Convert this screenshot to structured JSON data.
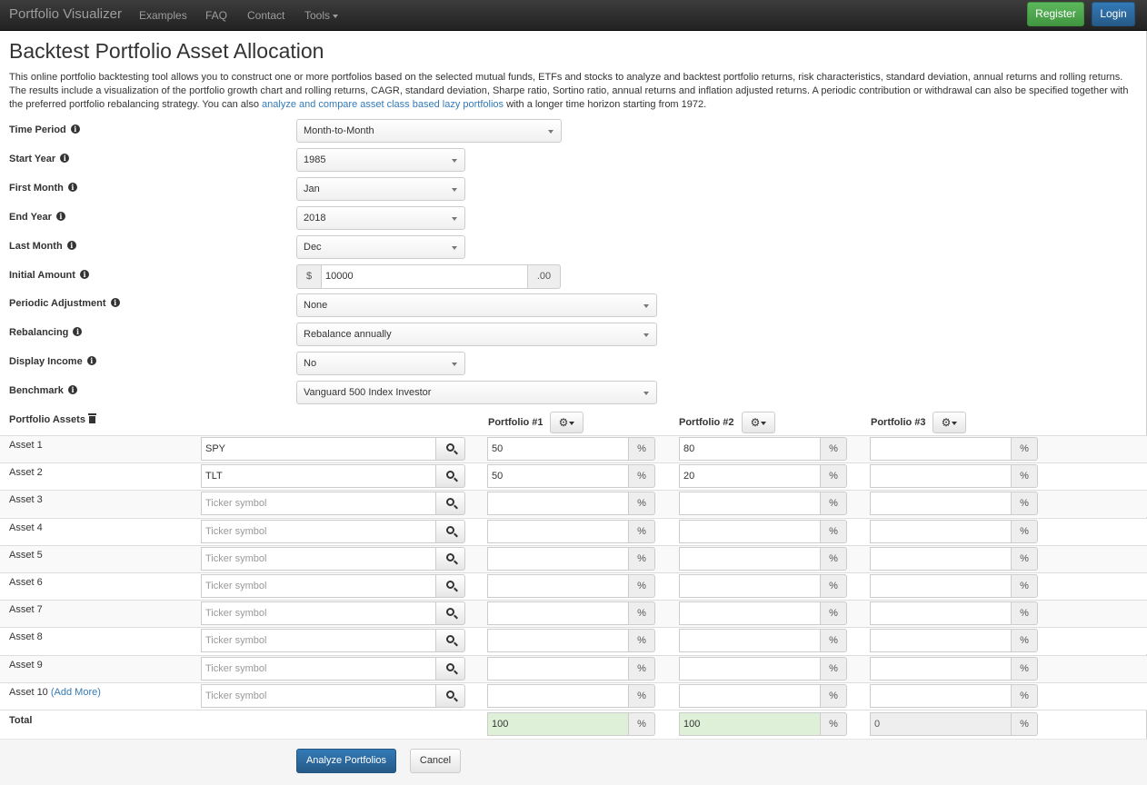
{
  "navbar": {
    "brand": "Portfolio Visualizer",
    "links": [
      "Examples",
      "FAQ",
      "Contact",
      "Tools"
    ],
    "register": "Register",
    "login": "Login"
  },
  "page": {
    "title": "Backtest Portfolio Asset Allocation",
    "description_part1": "This online portfolio backtesting tool allows you to construct one or more portfolios based on the selected mutual funds, ETFs and stocks to analyze and backtest portfolio returns, risk characteristics, standard deviation, annual returns and rolling returns. The results include a visualization of the portfolio growth chart and rolling returns, CAGR, standard deviation, Sharpe ratio, Sortino ratio, annual returns and inflation adjusted returns. A periodic contribution or withdrawal can also be specified together with the preferred portfolio rebalancing strategy. You can also ",
    "description_link": "analyze and compare asset class based lazy portfolios",
    "description_part2": " with a longer time horizon starting from 1972."
  },
  "form": {
    "time_period": {
      "label": "Time Period",
      "value": "Month-to-Month"
    },
    "start_year": {
      "label": "Start Year",
      "value": "1985"
    },
    "first_month": {
      "label": "First Month",
      "value": "Jan"
    },
    "end_year": {
      "label": "End Year",
      "value": "2018"
    },
    "last_month": {
      "label": "Last Month",
      "value": "Dec"
    },
    "initial_amount": {
      "label": "Initial Amount",
      "prefix": "$",
      "value": "10000",
      "suffix": ".00"
    },
    "periodic_adjustment": {
      "label": "Periodic Adjustment",
      "value": "None"
    },
    "rebalancing": {
      "label": "Rebalancing",
      "value": "Rebalance annually"
    },
    "display_income": {
      "label": "Display Income",
      "value": "No"
    },
    "benchmark": {
      "label": "Benchmark",
      "value": "Vanguard 500 Index Investor"
    }
  },
  "assets": {
    "header": "Portfolio Assets",
    "portfolios": [
      "Portfolio #1",
      "Portfolio #2",
      "Portfolio #3"
    ],
    "ticker_placeholder": "Ticker symbol",
    "percent_symbol": "%",
    "add_more": "(Add More)",
    "rows": [
      {
        "label": "Asset 1",
        "ticker": "SPY",
        "p1": "50",
        "p2": "80",
        "p3": ""
      },
      {
        "label": "Asset 2",
        "ticker": "TLT",
        "p1": "50",
        "p2": "20",
        "p3": ""
      },
      {
        "label": "Asset 3",
        "ticker": "",
        "p1": "",
        "p2": "",
        "p3": ""
      },
      {
        "label": "Asset 4",
        "ticker": "",
        "p1": "",
        "p2": "",
        "p3": ""
      },
      {
        "label": "Asset 5",
        "ticker": "",
        "p1": "",
        "p2": "",
        "p3": ""
      },
      {
        "label": "Asset 6",
        "ticker": "",
        "p1": "",
        "p2": "",
        "p3": ""
      },
      {
        "label": "Asset 7",
        "ticker": "",
        "p1": "",
        "p2": "",
        "p3": ""
      },
      {
        "label": "Asset 8",
        "ticker": "",
        "p1": "",
        "p2": "",
        "p3": ""
      },
      {
        "label": "Asset 9",
        "ticker": "",
        "p1": "",
        "p2": "",
        "p3": ""
      },
      {
        "label": "Asset 10",
        "ticker": "",
        "p1": "",
        "p2": "",
        "p3": ""
      }
    ],
    "total": {
      "label": "Total",
      "p1": "100",
      "p2": "100",
      "p3": "0"
    }
  },
  "actions": {
    "analyze": "Analyze Portfolios",
    "cancel": "Cancel"
  },
  "colors": {
    "total_valid": "#dff0d8",
    "primary": "#337ab7",
    "success": "#5cb85c"
  }
}
